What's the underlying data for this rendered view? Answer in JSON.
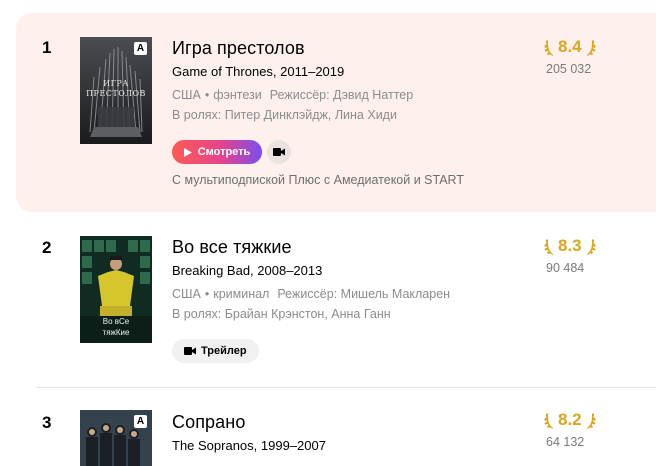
{
  "colors": {
    "rating": "#d9a61f",
    "highlight_bg": "#fef1ed",
    "watch_gradient": [
      "#ff5b53",
      "#e2448c",
      "#7d4cf1"
    ]
  },
  "films": [
    {
      "rank": "1",
      "title": "Игра престолов",
      "original": "Game of Thrones, 2011–2019",
      "country": "США",
      "genre": "фэнтези",
      "director": "Режиссёр: Дэвид Наттер",
      "cast": "В ролях: Питер Динклэйдж, Лина Хиди",
      "rating": "8.4",
      "votes": "205 032",
      "watch_label": "Смотреть",
      "subscription": "С мультиподпиской Плюс с Амедиатекой и START",
      "badge": "A",
      "poster_text": [
        "ИГРА",
        "ПРЕСТОЛОВ"
      ],
      "icons": [
        "play-icon",
        "camera-icon",
        "laurel-icon"
      ]
    },
    {
      "rank": "2",
      "title": "Во все тяжкие",
      "original": "Breaking Bad, 2008–2013",
      "country": "США",
      "genre": "криминал",
      "director": "Режиссёр: Мишель Макларен",
      "cast": "В ролях: Брайан Крэнстон, Анна Ганн",
      "rating": "8.3",
      "votes": "90 484",
      "trailer_label": "Трейлер",
      "poster_text": [
        "Во вСе",
        "тяжКие"
      ],
      "icons": [
        "camera-icon",
        "laurel-icon"
      ]
    },
    {
      "rank": "3",
      "title": "Сопрано",
      "original": "The Sopranos, 1999–2007",
      "rating": "8.2",
      "votes": "64 132",
      "badge": "A",
      "icons": [
        "laurel-icon"
      ]
    }
  ]
}
